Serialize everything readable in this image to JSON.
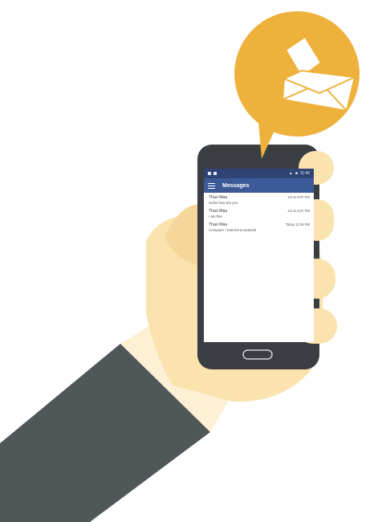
{
  "status_bar": {
    "time": "11:46"
  },
  "app_bar": {
    "title": "Messages"
  },
  "messages": [
    {
      "sender": "Thao Mau",
      "preview": "Hello! how are you",
      "time": "Jul 11 8:37 PM"
    },
    {
      "sender": "Thao Mau",
      "preview": "I am fine",
      "time": "Jul 11 8:37 PM"
    },
    {
      "sender": "Thao Mau",
      "preview": "Computer / Internet & Network",
      "time": "Today 12:36 PM"
    }
  ],
  "colors": {
    "badge": "#eeb13c",
    "skin": "#fbe3b0",
    "sleeve": "#505759",
    "phone": "#3a3d42",
    "app_bar": "#3d5a98"
  }
}
